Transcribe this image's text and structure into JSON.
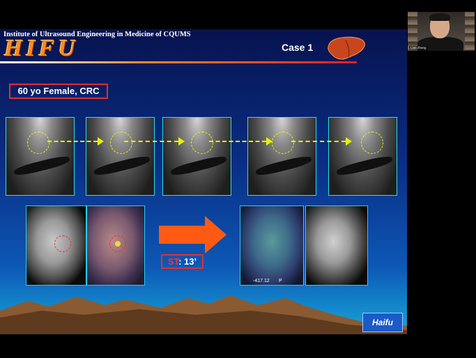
{
  "slide": {
    "institute": "Institute of Ultrasound Engineering in Medicine of CQUMS",
    "logo_text": "HIFU",
    "case_label": "Case 1",
    "patient_info": "60 yo Female, CRC",
    "st_prefix": "ST",
    "st_value": ": 13’",
    "ct_number": "-417.12",
    "ct_letter": "P",
    "brand": "Haifu",
    "colors": {
      "accent_red": "#e0302a",
      "target_yellow": "#e8f000",
      "arrow_orange": "#ff5a14",
      "frame_cyan": "#2ee0e0"
    }
  },
  "video": {
    "participant_name": "Lian Zhang"
  }
}
